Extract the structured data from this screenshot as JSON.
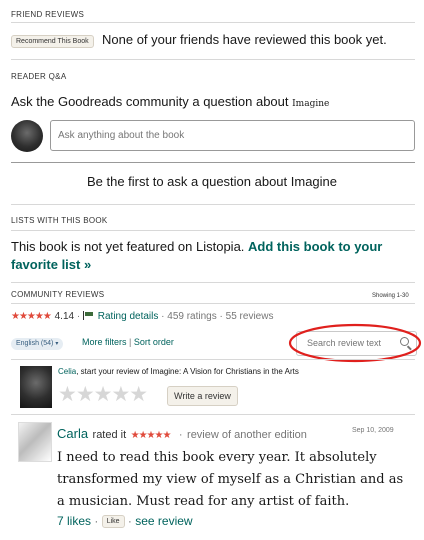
{
  "friend_reviews": {
    "header": "FRIEND REVIEWS",
    "recommend_button": "Recommend This Book",
    "message": "None of your friends have reviewed this book yet."
  },
  "reader_qa": {
    "header": "READER Q&A",
    "prompt_text": "Ask the Goodreads community a question about",
    "prompt_book": "Imagine",
    "input_placeholder": "Ask anything about the book",
    "empty_message": "Be the first to ask a question about Imagine"
  },
  "lists": {
    "header": "LISTS WITH THIS BOOK",
    "text": "This book is not yet featured on Listopia.",
    "link": "Add this book to your favorite list »"
  },
  "community_reviews": {
    "header": "COMMUNITY REVIEWS",
    "showing": "Showing 1-30",
    "avg_rating": "4.14",
    "avg_stars": "★★★★★",
    "rating_details": "Rating details",
    "ratings_count": "459 ratings",
    "reviews_count": "55 reviews",
    "separator": "·",
    "language_filter": "English (54)",
    "more_filters": "More filters",
    "pipe": "|",
    "sort_order": "Sort order",
    "search_placeholder": "Search review text"
  },
  "start_review": {
    "user_name": "Celia",
    "text": ", start your review of Imagine: A Vision for Christians in the Arts",
    "empty_stars": "★★★★★",
    "write_button": "Write a review"
  },
  "reviews": [
    {
      "user": "Carla",
      "action": "rated it",
      "stars": "★★★★★",
      "sep": "·",
      "note": "review of another edition",
      "date": "Sep 10, 2009",
      "body": "I need to read this book every year. It absolutely transformed my view of myself as a Christian and as a musician. Must read for any artist of faith.",
      "likes": "7 likes",
      "like_button": "Like",
      "sep2": "·",
      "see_review": "see review"
    }
  ],
  "colors": {
    "link": "#00635d",
    "star_orange": "#e87400",
    "star_red": "#e04a3b",
    "annotation_red": "#e0201d"
  }
}
